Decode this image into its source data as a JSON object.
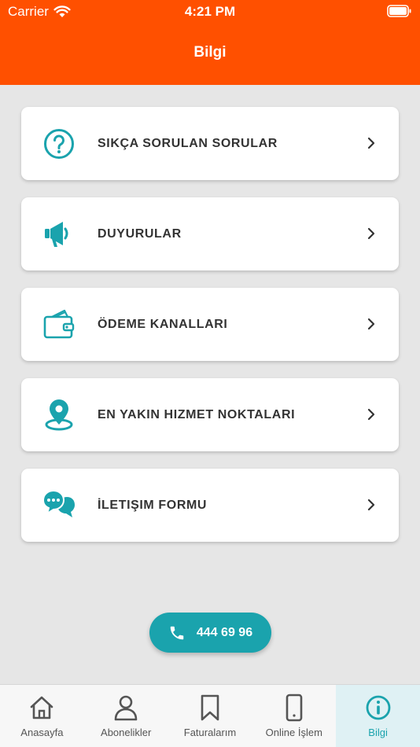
{
  "status_bar": {
    "carrier": "Carrier",
    "time": "4:21 PM"
  },
  "header": {
    "title": "Bilgi",
    "color": "#ff5000"
  },
  "menu": {
    "accent": "#1aa3ad",
    "items": [
      {
        "label": "SIKÇA SORULAN SORULAR",
        "icon": "question-circle-icon"
      },
      {
        "label": "DUYURULAR",
        "icon": "megaphone-icon"
      },
      {
        "label": "ÖDEME KANALLARI",
        "icon": "wallet-icon"
      },
      {
        "label": "EN YAKIN HIZMET NOKTALARI",
        "icon": "location-pin-icon"
      },
      {
        "label": "İLETIŞIM FORMU",
        "icon": "chat-bubbles-icon"
      }
    ]
  },
  "call_button": {
    "label": "444 69 96",
    "icon": "phone-icon"
  },
  "tab_bar": {
    "items": [
      {
        "label": "Anasayfa",
        "icon": "home-icon",
        "active": false
      },
      {
        "label": "Abonelikler",
        "icon": "user-icon",
        "active": false
      },
      {
        "label": "Faturalarım",
        "icon": "bookmark-icon",
        "active": false
      },
      {
        "label": "Online İşlem",
        "icon": "phone-device-icon",
        "active": false
      },
      {
        "label": "Bilgi",
        "icon": "info-circle-icon",
        "active": true
      }
    ]
  }
}
